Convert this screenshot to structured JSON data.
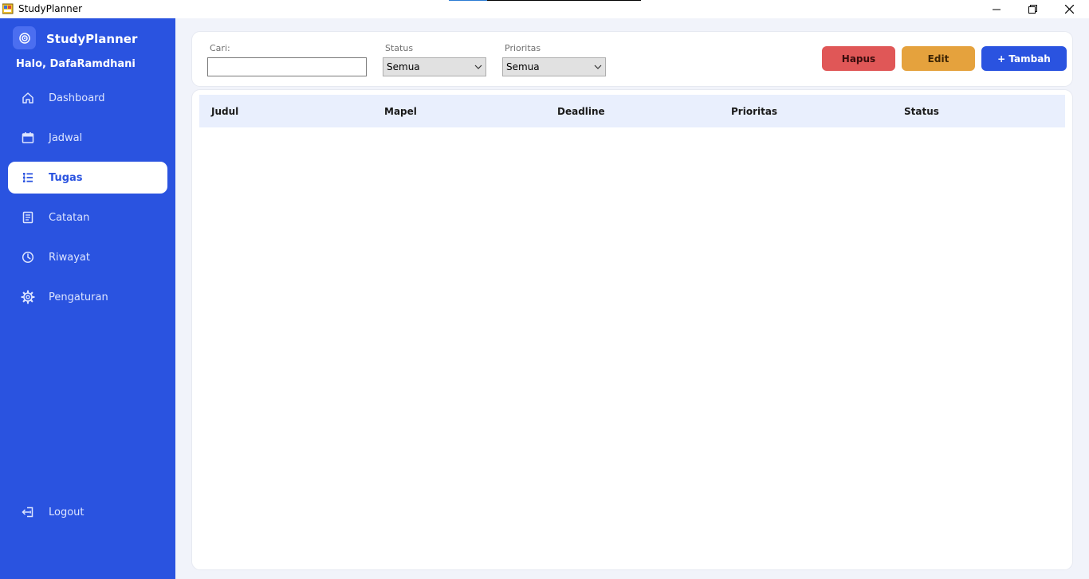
{
  "window": {
    "title": "StudyPlanner"
  },
  "sidebar": {
    "brand": "StudyPlanner",
    "greeting": "Halo, DafaRamdhani",
    "items": [
      {
        "label": "Dashboard",
        "icon": "home-icon"
      },
      {
        "label": "Jadwal",
        "icon": "calendar-icon"
      },
      {
        "label": "Tugas",
        "icon": "task-list-icon",
        "active": true
      },
      {
        "label": "Catatan",
        "icon": "note-icon"
      },
      {
        "label": "Riwayat",
        "icon": "clock-icon"
      },
      {
        "label": "Pengaturan",
        "icon": "gear-icon"
      }
    ],
    "logout": "Logout"
  },
  "filters": {
    "search_label": "Cari:",
    "search_value": "",
    "status_label": "Status",
    "status_value": "Semua",
    "priority_label": "Prioritas",
    "priority_value": "Semua"
  },
  "actions": {
    "delete_label": "Hapus",
    "edit_label": "Edit",
    "add_label": "+ Tambah"
  },
  "table": {
    "columns": [
      "Judul",
      "Mapel",
      "Deadline",
      "Prioritas",
      "Status"
    ],
    "rows": []
  },
  "colors": {
    "sidebar": "#2a53e0",
    "danger": "#e05757",
    "warning": "#e5a23d",
    "primary": "#2a53e0"
  }
}
